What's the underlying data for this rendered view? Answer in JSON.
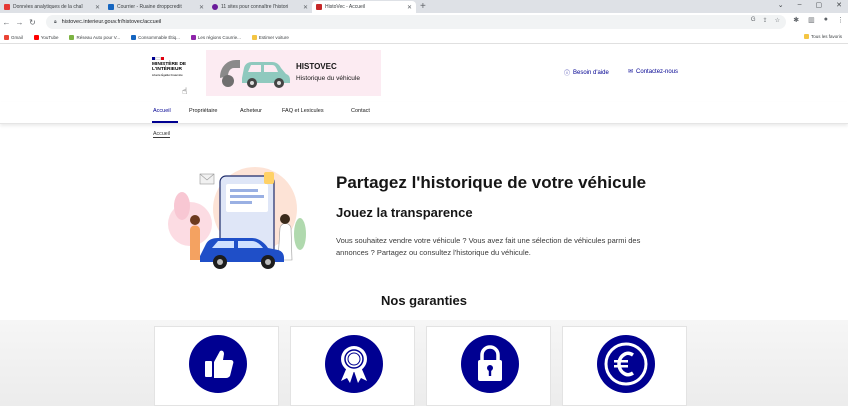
{
  "browser": {
    "tabs": [
      {
        "title": "Données analytiques de la chaî",
        "color": "#e53935",
        "active": false
      },
      {
        "title": "Courrier - Ruaine droppcredit",
        "color": "#1565c0",
        "active": false
      },
      {
        "title": "11 sites pour connaître l'histori",
        "color": "#6a1b9a",
        "active": false
      },
      {
        "title": "HistoVec - Accueil",
        "color": "#c62828",
        "active": true
      }
    ],
    "new_tab": "+",
    "window_controls": [
      "⌄",
      "–",
      "▢",
      "✕"
    ],
    "url": "histovec.interieur.gouv.fr/histovec/accueil",
    "bookmarks": [
      {
        "label": "Gmail",
        "color": "#ea4335"
      },
      {
        "label": "YouTube",
        "color": "#ff0000"
      },
      {
        "label": "Réseau Auto pour V...",
        "color": "#7cb342"
      },
      {
        "label": "Consommable Étiq...",
        "color": "#1565c0"
      },
      {
        "label": "Les régions Courrie...",
        "color": "#8e24aa"
      },
      {
        "label": "Estimer voiture",
        "color": "#f4c542"
      }
    ],
    "bookmarks_right": "Tous les favoris"
  },
  "header": {
    "ministry": "MINISTÈRE DE L'INTÉRIEUR",
    "devise": "Liberté Égalité Fraternité",
    "brand": "HISTOVEC",
    "tagline": "Historique du véhicule",
    "help_link": "Besoin d'aide",
    "contact_link": "Contactez-nous",
    "colors": {
      "accent": "#000091",
      "banner_bg": "#fcebf2"
    }
  },
  "nav": {
    "items": [
      "Accueil",
      "Propriétaire",
      "Acheteur",
      "FAQ et Lexicules",
      "Contact"
    ]
  },
  "breadcrumb": "Accueil",
  "hero": {
    "title": "Partagez l'historique de votre véhicule",
    "subtitle": "Jouez la transparence",
    "text": "Vous souhaitez vendre votre véhicule ? Vous avez fait une sélection de véhicules parmi des annonces ? Partagez ou consultez l'historique du véhicule."
  },
  "guarantees": {
    "title": "Nos garanties",
    "cards": [
      {
        "icon": "thumbs-up-icon"
      },
      {
        "icon": "award-medal-icon"
      },
      {
        "icon": "padlock-icon"
      },
      {
        "icon": "euro-icon"
      }
    ]
  }
}
